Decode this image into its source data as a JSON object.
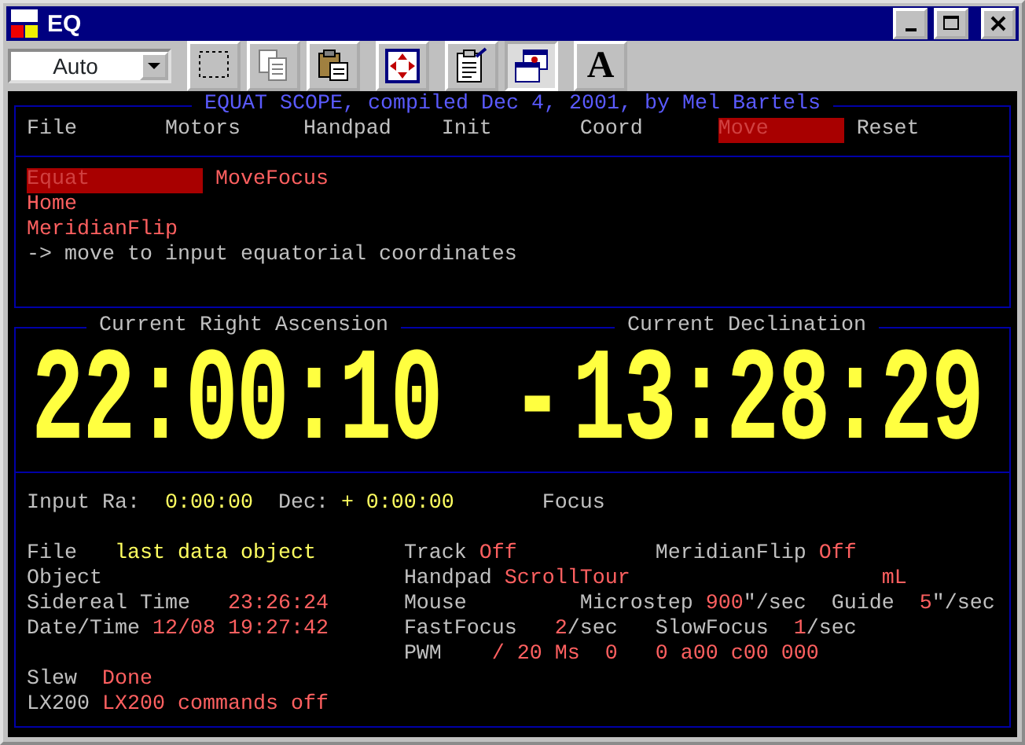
{
  "window": {
    "title": "EQ"
  },
  "toolbar": {
    "font_select": "Auto",
    "buttons": [
      {
        "kind": "mark",
        "pressed": false
      },
      {
        "kind": "copy",
        "pressed": false
      },
      {
        "kind": "paste",
        "pressed": false
      },
      {
        "kind": "fullscreen",
        "pressed": false
      },
      {
        "kind": "properties",
        "pressed": false
      },
      {
        "kind": "background",
        "pressed": true
      },
      {
        "kind": "font",
        "label": "A",
        "pressed": false
      }
    ]
  },
  "console": {
    "title": "EQUAT SCOPE, compiled Dec 4, 2001, by Mel Bartels",
    "menu": [
      {
        "label": "File",
        "selected": false
      },
      {
        "label": "Motors",
        "selected": false
      },
      {
        "label": "Handpad",
        "selected": false
      },
      {
        "label": "Init",
        "selected": false
      },
      {
        "label": "Coord",
        "selected": false
      },
      {
        "label": "Move",
        "selected": true
      },
      {
        "label": "Reset",
        "selected": false
      }
    ],
    "submenu": [
      {
        "label": "Equat",
        "selected": true
      },
      {
        "label": "Home",
        "selected": false
      },
      {
        "label": "MeridianFlip",
        "selected": false
      },
      {
        "label": "MoveFocus",
        "selected": false
      }
    ],
    "hint": "-> move to input equatorial coordinates",
    "ra": {
      "label": "Current Right Ascension",
      "value": "22:00:10"
    },
    "dec": {
      "label": "Current Declination",
      "sign": "-",
      "value": "13:28:29"
    },
    "input": [
      {
        "text": "Input Ra:",
        "kind": "label"
      },
      {
        "text": "0:00:00",
        "kind": "entry"
      },
      {
        "text": "Dec:",
        "kind": "label"
      },
      {
        "text": "+ 0:00:00",
        "kind": "entry"
      },
      {
        "text": "Focus",
        "kind": "label"
      }
    ],
    "status_left": [
      [
        {
          "text": "File",
          "kind": "label"
        },
        {
          "text": "last data object",
          "kind": "entry"
        }
      ],
      [
        {
          "text": "Object",
          "kind": "label"
        }
      ],
      [
        {
          "text": "Sidereal Time",
          "kind": "label"
        },
        {
          "text": "23:26:24",
          "kind": "value"
        }
      ],
      [
        {
          "text": "Date/Time",
          "kind": "label"
        },
        {
          "text": "12/08 19:27:42",
          "kind": "value"
        }
      ],
      [
        {
          "text": "Slew",
          "kind": "label"
        },
        {
          "text": "Done",
          "kind": "value"
        }
      ],
      [
        {
          "text": "LX200",
          "kind": "label"
        },
        {
          "text": "LX200 commands off",
          "kind": "value"
        }
      ]
    ],
    "status_right": [
      [
        {
          "text": "Track",
          "kind": "label"
        },
        {
          "text": "Off",
          "kind": "value"
        },
        {
          "text": "MeridianFlip",
          "kind": "label"
        },
        {
          "text": "Off",
          "kind": "value"
        }
      ],
      [
        {
          "text": "Handpad",
          "kind": "label"
        },
        {
          "text": "ScrollTour",
          "kind": "value"
        },
        {
          "text": "mL",
          "kind": "value"
        }
      ],
      [
        {
          "text": "Mouse",
          "kind": "label"
        },
        {
          "text": "Microstep",
          "kind": "label"
        },
        {
          "text": "900",
          "kind": "value"
        },
        {
          "text": "\"/sec",
          "kind": "label"
        },
        {
          "text": "Guide",
          "kind": "label"
        },
        {
          "text": "5",
          "kind": "value"
        },
        {
          "text": "\"/sec",
          "kind": "label"
        }
      ],
      [
        {
          "text": "FastFocus",
          "kind": "label"
        },
        {
          "text": "2",
          "kind": "value"
        },
        {
          "text": "/sec",
          "kind": "label"
        },
        {
          "text": "SlowFocus",
          "kind": "label"
        },
        {
          "text": "1",
          "kind": "value"
        },
        {
          "text": "/sec",
          "kind": "label"
        }
      ],
      [
        {
          "text": "PWM",
          "kind": "label"
        },
        {
          "text": "/ 20 Ms",
          "kind": "value"
        },
        {
          "text": "0",
          "kind": "value"
        },
        {
          "text": "0 a00 c00 000",
          "kind": "value"
        }
      ]
    ]
  }
}
